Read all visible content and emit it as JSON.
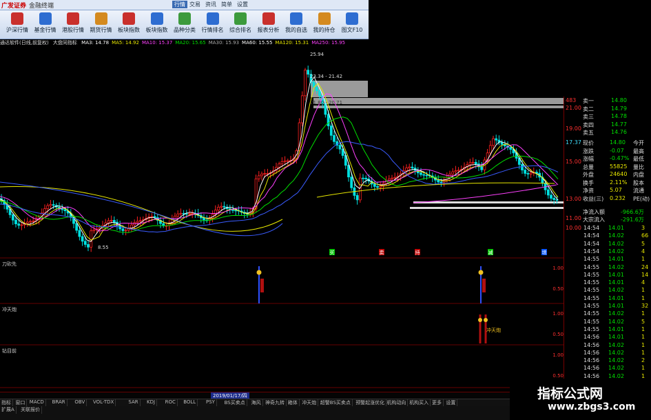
{
  "app": {
    "logo": "广发证券",
    "subtitle": "金融终端"
  },
  "menu": [
    {
      "label": "行情",
      "active": true
    },
    {
      "label": "交易",
      "active": false
    },
    {
      "label": "资讯",
      "active": false
    },
    {
      "label": "简单",
      "active": false
    },
    {
      "label": "设置",
      "active": false
    }
  ],
  "toolbar": [
    {
      "label": "沪深行情",
      "icon": "chart-icon",
      "color": "#c9302c"
    },
    {
      "label": "基金行情",
      "icon": "chart-icon",
      "color": "#2e6dd1"
    },
    {
      "label": "港股行情",
      "icon": "chart-icon",
      "color": "#c9302c"
    },
    {
      "label": "期货行情",
      "icon": "chart-icon",
      "color": "#d48a1f"
    },
    {
      "label": "板块指数",
      "icon": "pie-icon",
      "color": "#c9302c"
    },
    {
      "label": "板块指数",
      "icon": "grid-icon",
      "color": "#2e6dd1"
    },
    {
      "label": "品种分类",
      "icon": "list-icon",
      "color": "#3c9a3c"
    },
    {
      "label": "行情排名",
      "icon": "rank-icon",
      "color": "#2e6dd1"
    },
    {
      "label": "综合排名",
      "icon": "rank-icon",
      "color": "#3c9a3c"
    },
    {
      "label": "报表分析",
      "icon": "report-icon",
      "color": "#c9302c"
    },
    {
      "label": "我的自选",
      "icon": "star-icon",
      "color": "#2e6dd1"
    },
    {
      "label": "我的持仓",
      "icon": "bag-icon",
      "color": "#d48a1f"
    },
    {
      "label": "图文F10",
      "icon": "doc-icon",
      "color": "#2e6dd1"
    }
  ],
  "chart_info": {
    "title": "通达软件(日线,前复权)",
    "indicator": "大盘同指标",
    "ma": [
      {
        "label": "MA3: 14.78",
        "color": "#ffffff"
      },
      {
        "label": "MA5: 14.92",
        "color": "#e8e800"
      },
      {
        "label": "MA10: 15.37",
        "color": "#ff40ff"
      },
      {
        "label": "MA20: 15.65",
        "color": "#00e000"
      },
      {
        "label": "MA30: 15.93",
        "color": "#aaaaaa"
      },
      {
        "label": "MA60: 15.55",
        "color": "#ffffff"
      },
      {
        "label": "MA120: 15.31",
        "color": "#e8e800"
      },
      {
        "label": "MA250: 15.95",
        "color": "#ff40ff"
      }
    ]
  },
  "price_annotations": {
    "high": "25.94",
    "mid1": "23.34 - 21.42",
    "mid2": "21.80 - 20.71",
    "low": "8.55"
  },
  "price_axis": [
    "483",
    "21.00",
    "19.00",
    "17.37",
    "15.00",
    "13.00",
    "11.00",
    "10.00"
  ],
  "markers": [
    "买",
    "卖",
    "持",
    "减",
    "增"
  ],
  "subpanels": [
    {
      "label": "刀砍先",
      "axis": [
        "1.00",
        "0.50"
      ]
    },
    {
      "label": "冲天炮",
      "axis": [
        "1.00",
        "0.50"
      ],
      "annotation": "冲天炮"
    },
    {
      "label": "钻目前",
      "axis": [
        "1.00",
        "0.50"
      ]
    }
  ],
  "date_label": "2019/01/17/四",
  "quote": {
    "orders": [
      {
        "label": "卖一",
        "price": "14.80"
      },
      {
        "label": "卖二",
        "price": "14.79"
      },
      {
        "label": "卖三",
        "price": "14.78"
      },
      {
        "label": "卖四",
        "price": "14.77"
      },
      {
        "label": "卖五",
        "price": "14.76"
      }
    ],
    "stats": [
      {
        "l1": "现价",
        "v1": "14.80",
        "l2": "今开",
        "v2": ""
      },
      {
        "l1": "涨跌",
        "v1": "-0.07",
        "l2": "最高",
        "v2": ""
      },
      {
        "l1": "涨幅",
        "v1": "-0.47%",
        "l2": "最低",
        "v2": ""
      },
      {
        "l1": "总量",
        "v1": "55825",
        "l2": "量比",
        "v2": ""
      },
      {
        "l1": "外盘",
        "v1": "24640",
        "l2": "内盘",
        "v2": ""
      },
      {
        "l1": "换手",
        "v1": "2.11%",
        "l2": "股本",
        "v2": ""
      },
      {
        "l1": "净资",
        "v1": "5.07",
        "l2": "流通",
        "v2": ""
      },
      {
        "l1": "收益(三)",
        "v1": "0.232",
        "l2": "PE(动)",
        "v2": ""
      }
    ],
    "flows": [
      {
        "label": "净流入额",
        "value": "-966.6万"
      },
      {
        "label": "大宗流入",
        "value": "-291.6万"
      }
    ],
    "ticks": [
      {
        "time": "14:54",
        "price": "14.01",
        "vol": "3"
      },
      {
        "time": "14:54",
        "price": "14.02",
        "vol": "66"
      },
      {
        "time": "14:54",
        "price": "14.02",
        "vol": "5"
      },
      {
        "time": "14:54",
        "price": "14.02",
        "vol": "4"
      },
      {
        "time": "14:55",
        "price": "14.01",
        "vol": "1"
      },
      {
        "time": "14:55",
        "price": "14.02",
        "vol": "24"
      },
      {
        "time": "14:55",
        "price": "14.01",
        "vol": "14"
      },
      {
        "time": "14:55",
        "price": "14.01",
        "vol": "4"
      },
      {
        "time": "14:55",
        "price": "14.02",
        "vol": "1"
      },
      {
        "time": "14:55",
        "price": "14.01",
        "vol": "1"
      },
      {
        "time": "14:55",
        "price": "14.01",
        "vol": "32"
      },
      {
        "time": "14:55",
        "price": "14.02",
        "vol": "1"
      },
      {
        "time": "14:55",
        "price": "14.02",
        "vol": "5"
      },
      {
        "time": "14:55",
        "price": "14.01",
        "vol": "1"
      },
      {
        "time": "14:56",
        "price": "14.01",
        "vol": "1"
      },
      {
        "time": "14:56",
        "price": "14.02",
        "vol": "1"
      },
      {
        "time": "14:56",
        "price": "14.02",
        "vol": "1"
      },
      {
        "time": "14:56",
        "price": "14.02",
        "vol": "2"
      },
      {
        "time": "14:56",
        "price": "14.02",
        "vol": "1"
      },
      {
        "time": "14:56",
        "price": "14.02",
        "vol": "1"
      },
      {
        "time": "14:56",
        "price": "14.01",
        "vol": "1"
      },
      {
        "time": "14:56",
        "price": "14.02",
        "vol": "1"
      }
    ]
  },
  "tabs": [
    "指标",
    "窗口",
    "MACD",
    "BRAR",
    "OBV",
    "VOL-TDX",
    "SAR",
    "KDJ",
    "ROC",
    "BOLL",
    "PSY",
    "BS买卖点",
    "海风",
    "神奇九转",
    "箱体",
    "冲天炮",
    "超警BS买卖点",
    "预警起涨优化",
    "机构动向",
    "机构买入",
    "更多",
    "设置"
  ],
  "bottom_links": [
    "扩展A",
    "关联报价"
  ],
  "watermark": {
    "line1": "指标公式网",
    "line2": "www.zbgs3.com"
  }
}
